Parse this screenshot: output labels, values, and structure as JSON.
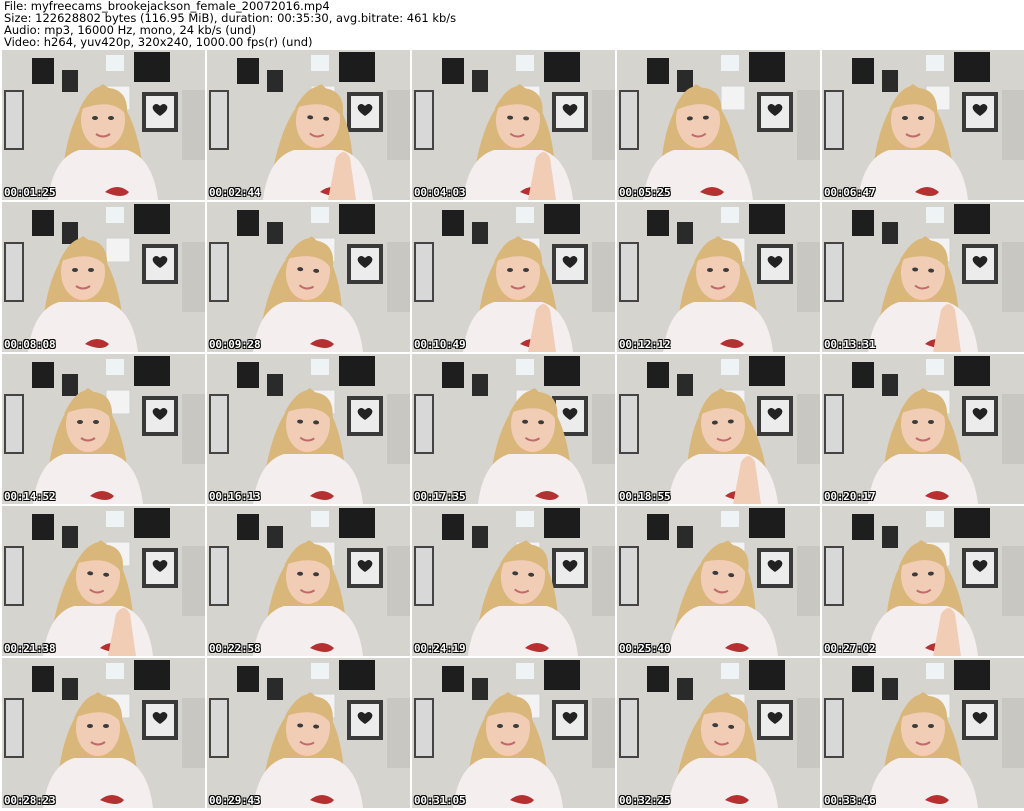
{
  "header": {
    "file_line": "File: myfreecams_brookejackson_female_20072016.mp4",
    "size_line": "Size: 122628802 bytes (116.95 MiB), duration: 00:35:30, avg.bitrate: 461 kb/s",
    "audio_line": "Audio: mp3, 16000 Hz, mono, 24 kb/s (und)",
    "video_line": "Video: h264, yuv420p, 320x240, 1000.00 fps(r) (und)"
  },
  "thumbnails": [
    {
      "timestamp": "00:01:25"
    },
    {
      "timestamp": "00:02:44"
    },
    {
      "timestamp": "00:04:03"
    },
    {
      "timestamp": "00:05:25"
    },
    {
      "timestamp": "00:06:47"
    },
    {
      "timestamp": "00:08:08"
    },
    {
      "timestamp": "00:09:28"
    },
    {
      "timestamp": "00:10:49"
    },
    {
      "timestamp": "00:12:12"
    },
    {
      "timestamp": "00:13:31"
    },
    {
      "timestamp": "00:14:52"
    },
    {
      "timestamp": "00:16:13"
    },
    {
      "timestamp": "00:17:35"
    },
    {
      "timestamp": "00:18:55"
    },
    {
      "timestamp": "00:20:17"
    },
    {
      "timestamp": "00:21:38"
    },
    {
      "timestamp": "00:22:58"
    },
    {
      "timestamp": "00:24:19"
    },
    {
      "timestamp": "00:25:40"
    },
    {
      "timestamp": "00:27:02"
    },
    {
      "timestamp": "00:28:23"
    },
    {
      "timestamp": "00:29:43"
    },
    {
      "timestamp": "00:31:05"
    },
    {
      "timestamp": "00:32:25"
    },
    {
      "timestamp": "00:33:46"
    }
  ],
  "colors": {
    "wall": "#d6d4cf",
    "hair": "#d9b77a",
    "skin": "#f1cdb6",
    "shirt": "#f4eeee",
    "frame": "#2b2b2b"
  }
}
